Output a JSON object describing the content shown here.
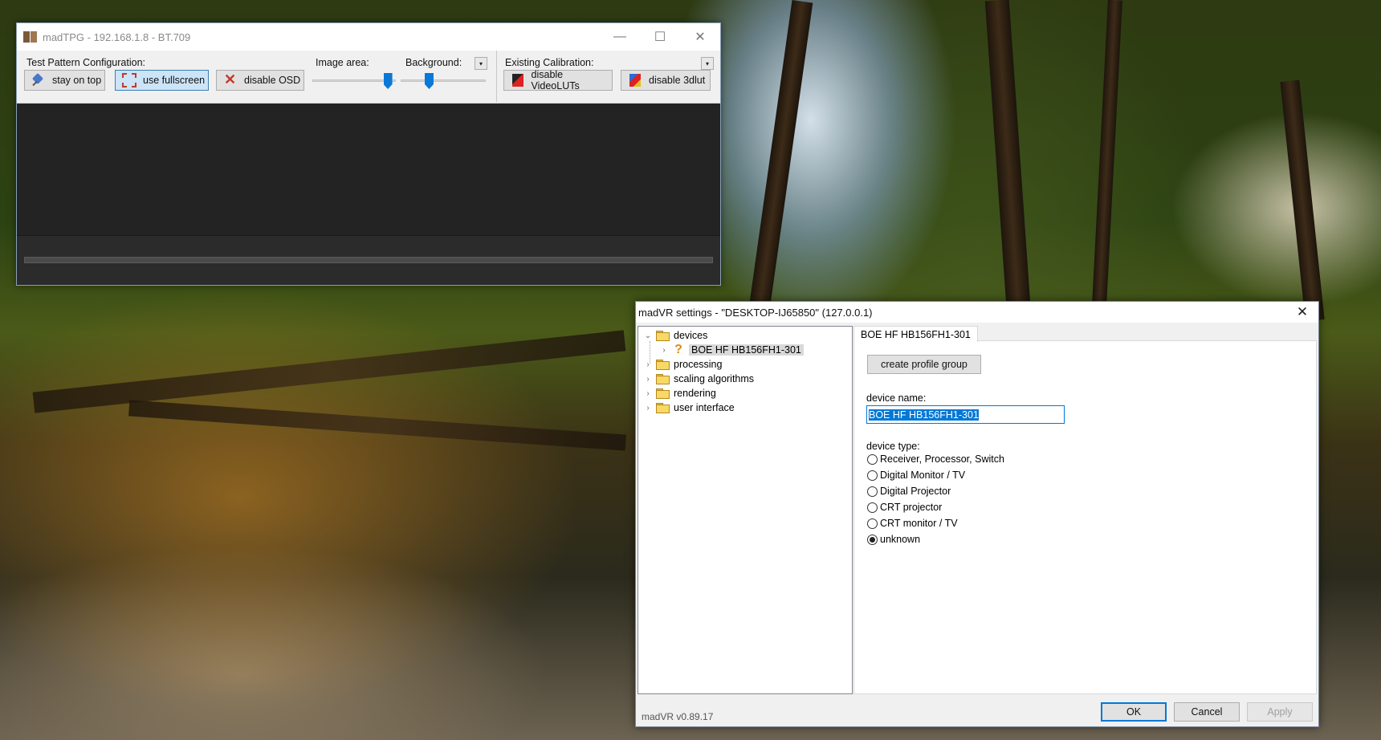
{
  "tpg": {
    "title": "madTPG  -  192.168.1.8  -  BT.709",
    "controls": {
      "minimize": "—",
      "maximize": "☐",
      "close": "✕"
    },
    "section_test": "Test Pattern Configuration:",
    "section_image_area": "Image area:",
    "section_background": "Background:",
    "section_calibration": "Existing Calibration:",
    "buttons": {
      "stay_on_top": "stay on top",
      "use_fullscreen": "use fullscreen",
      "disable_osd": "disable OSD",
      "disable_videoluts": "disable VideoLUTs",
      "disable_3dlut": "disable 3dlut"
    },
    "dropdown_glyph": "▾",
    "image_area_level": 0.9,
    "background_level": 0.33
  },
  "settings": {
    "title": "madVR settings - \"DESKTOP-IJ65850\" (127.0.0.1)",
    "close": "✕",
    "tree": [
      {
        "label": "devices",
        "chev": "⌄"
      },
      {
        "label": "BOE HF HB156FH1-301",
        "chev": "›"
      },
      {
        "label": "processing",
        "chev": "›"
      },
      {
        "label": "scaling algorithms",
        "chev": "›"
      },
      {
        "label": "rendering",
        "chev": "›"
      },
      {
        "label": "user interface",
        "chev": "›"
      }
    ],
    "tab_label": "BOE HF HB156FH1-301",
    "create_profile_group": "create profile group",
    "device_name_label": "device name:",
    "device_name_value": "BOE HF HB156FH1-301",
    "device_type_label": "device type:",
    "device_types": [
      "Receiver, Processor, Switch",
      "Digital Monitor / TV",
      "Digital Projector",
      "CRT projector",
      "CRT monitor / TV",
      "unknown"
    ],
    "selected_device_type": "unknown",
    "version": "madVR v0.89.17",
    "ok": "OK",
    "cancel": "Cancel",
    "apply": "Apply"
  }
}
